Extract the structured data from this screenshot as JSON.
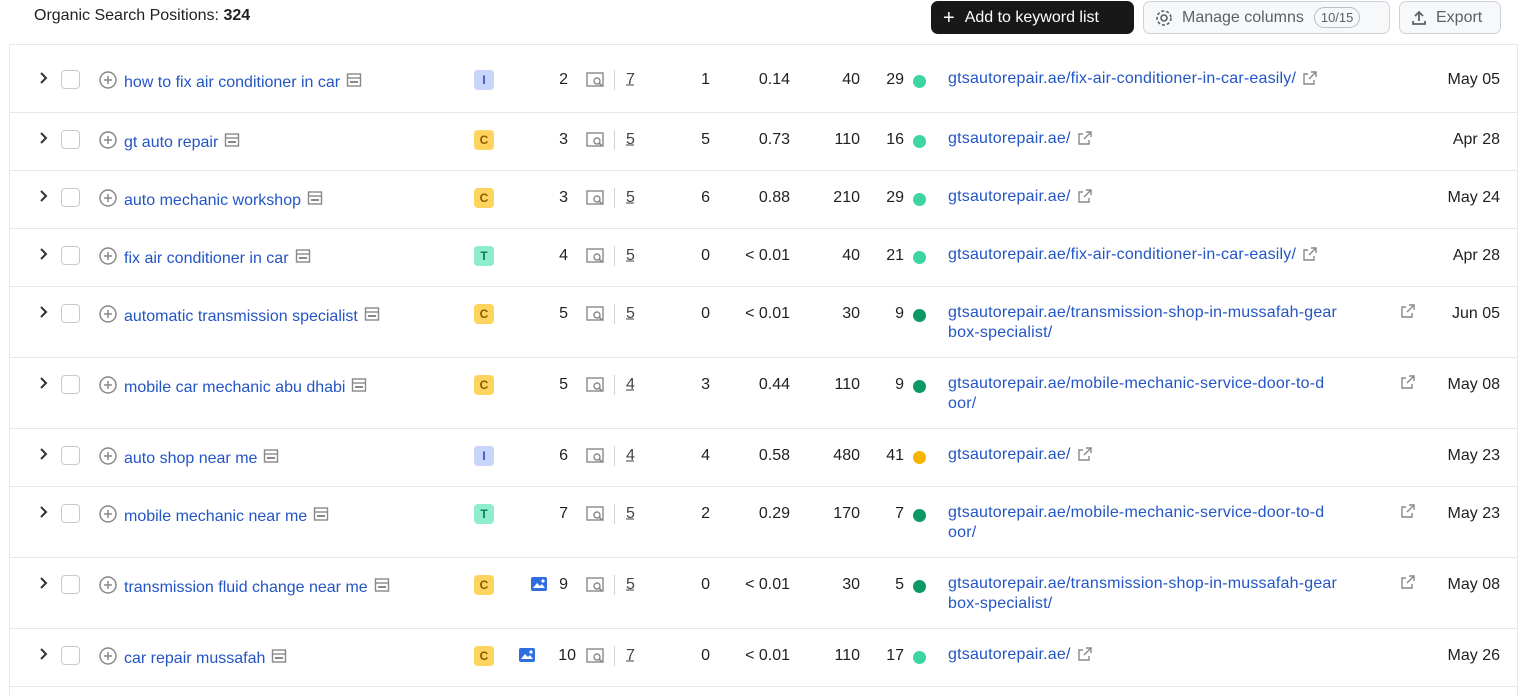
{
  "header": {
    "title_label": "Organic Search Positions:",
    "title_count": "324",
    "add_button": "Add to keyword list",
    "manage_button": "Manage columns",
    "manage_count": "10/15",
    "export_button": "Export"
  },
  "colors": {
    "link": "#2355c4",
    "dot_light_green": "#3dd6a3",
    "dot_dark_green": "#0d9963",
    "dot_orange": "#f7b500"
  },
  "rows": [
    {
      "keyword": "how to fix air conditioner in car",
      "intent": "I",
      "serp_image": false,
      "position": "2",
      "results": "7",
      "volume": "1",
      "kd": "0.14",
      "cpc": "40",
      "traffic": "29",
      "dot": "light-green",
      "url": "gtsautorepair.ae/fix-air-conditioner-in-car-easily/",
      "url2": "",
      "date": "May 05"
    },
    {
      "keyword": "gt auto repair",
      "intent": "C",
      "serp_image": false,
      "position": "3",
      "results": "5",
      "volume": "5",
      "kd": "0.73",
      "cpc": "110",
      "traffic": "16",
      "dot": "light-green",
      "url": "gtsautorepair.ae/",
      "url2": "",
      "date": "Apr 28"
    },
    {
      "keyword": "auto mechanic workshop",
      "intent": "C",
      "serp_image": false,
      "position": "3",
      "results": "5",
      "volume": "6",
      "kd": "0.88",
      "cpc": "210",
      "traffic": "29",
      "dot": "light-green",
      "url": "gtsautorepair.ae/",
      "url2": "",
      "date": "May 24"
    },
    {
      "keyword": "fix air conditioner in car",
      "intent": "T",
      "serp_image": false,
      "position": "4",
      "results": "5",
      "volume": "0",
      "kd": "< 0.01",
      "cpc": "40",
      "traffic": "21",
      "dot": "light-green",
      "url": "gtsautorepair.ae/fix-air-conditioner-in-car-easily/",
      "url2": "",
      "date": "Apr 28"
    },
    {
      "keyword": "automatic transmission specialist",
      "intent": "C",
      "serp_image": false,
      "position": "5",
      "results": "5",
      "volume": "0",
      "kd": "< 0.01",
      "cpc": "30",
      "traffic": "9",
      "dot": "dark-green",
      "url": "gtsautorepair.ae/transmission-shop-in-mussafah-gear",
      "url2": "box-specialist/",
      "date": "Jun 05"
    },
    {
      "keyword": "mobile car mechanic abu dhabi",
      "intent": "C",
      "serp_image": false,
      "position": "5",
      "results": "4",
      "volume": "3",
      "kd": "0.44",
      "cpc": "110",
      "traffic": "9",
      "dot": "dark-green",
      "url": "gtsautorepair.ae/mobile-mechanic-service-door-to-d",
      "url2": "oor/",
      "date": "May 08"
    },
    {
      "keyword": "auto shop near me",
      "intent": "I",
      "serp_image": false,
      "position": "6",
      "results": "4",
      "volume": "4",
      "kd": "0.58",
      "cpc": "480",
      "traffic": "41",
      "dot": "orange",
      "url": "gtsautorepair.ae/",
      "url2": "",
      "date": "May 23"
    },
    {
      "keyword": "mobile mechanic near me",
      "intent": "T",
      "serp_image": false,
      "position": "7",
      "results": "5",
      "volume": "2",
      "kd": "0.29",
      "cpc": "170",
      "traffic": "7",
      "dot": "dark-green",
      "url": "gtsautorepair.ae/mobile-mechanic-service-door-to-d",
      "url2": "oor/",
      "date": "May 23"
    },
    {
      "keyword": "transmission fluid change near me",
      "intent": "C",
      "serp_image": true,
      "position": "9",
      "results": "5",
      "volume": "0",
      "kd": "< 0.01",
      "cpc": "30",
      "traffic": "5",
      "dot": "dark-green",
      "url": "gtsautorepair.ae/transmission-shop-in-mussafah-gear",
      "url2": "box-specialist/",
      "date": "May 08"
    },
    {
      "keyword": "car repair mussafah",
      "intent": "C",
      "serp_image": true,
      "position": "10",
      "results": "7",
      "volume": "0",
      "kd": "< 0.01",
      "cpc": "110",
      "traffic": "17",
      "dot": "light-green",
      "url": "gtsautorepair.ae/",
      "url2": "",
      "date": "May 26"
    }
  ]
}
